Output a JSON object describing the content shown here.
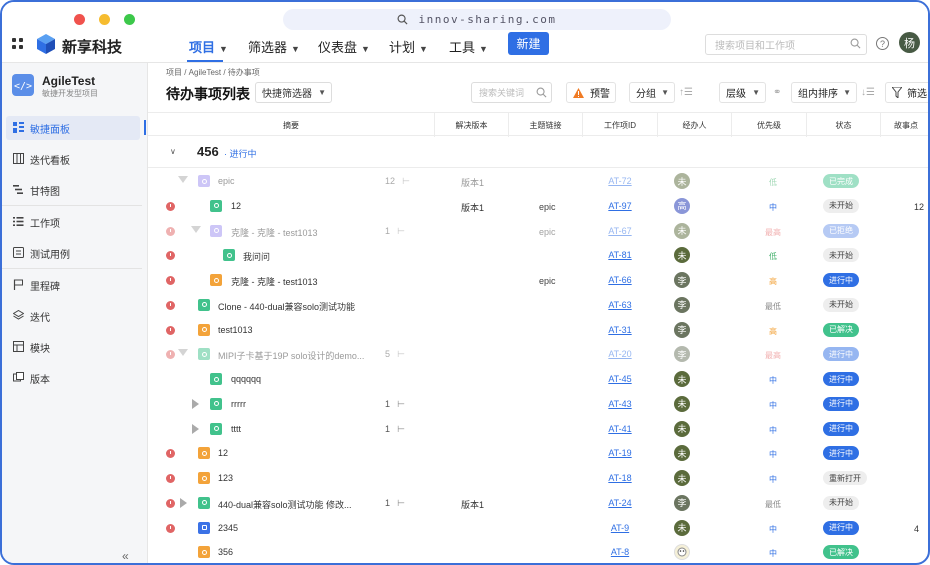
{
  "url": "innov-sharing.com",
  "brand": "新享科技",
  "nav": {
    "items": [
      {
        "label": "项目",
        "active": true
      },
      {
        "label": "筛选器"
      },
      {
        "label": "仪表盘"
      },
      {
        "label": "计划"
      },
      {
        "label": "工具"
      }
    ],
    "new_button": "新建",
    "search_placeholder": "搜索项目和工作项",
    "user_initial": "杨"
  },
  "sidebar": {
    "project_name": "AgileTest",
    "project_sub": "敏捷开发型项目",
    "items": [
      {
        "label": "敏捷面板",
        "icon": "board-icon",
        "active": true
      },
      {
        "label": "迭代看板",
        "icon": "kanban-icon"
      },
      {
        "label": "甘特图",
        "icon": "gantt-icon"
      },
      {
        "label": "工作项",
        "icon": "list-icon"
      },
      {
        "label": "测试用例",
        "icon": "testcase-icon"
      },
      {
        "label": "里程碑",
        "icon": "flag-icon"
      },
      {
        "label": "迭代",
        "icon": "layers-icon"
      },
      {
        "label": "模块",
        "icon": "module-icon"
      },
      {
        "label": "版本",
        "icon": "version-icon"
      }
    ],
    "collapse": "«"
  },
  "breadcrumb": "项目 / AgileTest / 待办事项",
  "page_title": "待办事项列表",
  "toolbar": {
    "quick_filter": "快捷筛选器",
    "keyword_placeholder": "搜索关键词",
    "warning": "预警",
    "group": "分组",
    "level": "层级",
    "inner_sort": "组内排序",
    "filter": "筛选"
  },
  "columns": [
    "摘要",
    "解决版本",
    "主题链接",
    "工作项ID",
    "经办人",
    "优先级",
    "状态",
    "故事点"
  ],
  "group": {
    "number": "456",
    "status": "· 进行中"
  },
  "colors": {
    "accent": "#2f6fe4",
    "overdue": "#e06565"
  },
  "rows": [
    {
      "title": "epic",
      "sub": "12",
      "version": "版本1",
      "topic": "",
      "id": "AT-72",
      "assignee": "未",
      "priority": "低",
      "status": "已完成",
      "points": "",
      "faded": true
    },
    {
      "title": "12",
      "sub": "",
      "version": "版本1",
      "topic": "epic",
      "id": "AT-97",
      "assignee": "高",
      "priority": "中",
      "status": "未开始",
      "points": "12",
      "faded": false
    },
    {
      "title": "克隆 - 克隆 - test1013",
      "sub": "1",
      "version": "",
      "topic": "epic",
      "id": "AT-67",
      "assignee": "未",
      "priority": "最高",
      "status": "已拒绝",
      "points": "",
      "faded": true
    },
    {
      "title": "我问问",
      "sub": "",
      "version": "",
      "topic": "",
      "id": "AT-81",
      "assignee": "未",
      "priority": "低",
      "status": "未开始",
      "points": "",
      "faded": false
    },
    {
      "title": "克隆 - 克隆 - test1013",
      "sub": "",
      "version": "",
      "topic": "epic",
      "id": "AT-66",
      "assignee": "李",
      "priority": "高",
      "status": "进行中",
      "points": "",
      "faded": false
    },
    {
      "title": "Clone - 440-dual兼容solo测试功能",
      "sub": "",
      "version": "",
      "topic": "",
      "id": "AT-63",
      "assignee": "李",
      "priority": "最低",
      "status": "未开始",
      "points": "",
      "faded": false
    },
    {
      "title": "test1013",
      "sub": "",
      "version": "",
      "topic": "",
      "id": "AT-31",
      "assignee": "李",
      "priority": "高",
      "status": "已解决",
      "points": "",
      "faded": false
    },
    {
      "title": "MIPI子卡基于19P solo设计的demo...",
      "sub": "5",
      "version": "",
      "topic": "",
      "id": "AT-20",
      "assignee": "李",
      "priority": "最高",
      "status": "进行中",
      "points": "",
      "faded": true
    },
    {
      "title": "qqqqqq",
      "sub": "",
      "version": "",
      "topic": "",
      "id": "AT-45",
      "assignee": "未",
      "priority": "中",
      "status": "进行中",
      "points": "",
      "faded": false
    },
    {
      "title": "rrrrr",
      "sub": "1",
      "version": "",
      "topic": "",
      "id": "AT-43",
      "assignee": "未",
      "priority": "中",
      "status": "进行中",
      "points": "",
      "faded": false
    },
    {
      "title": "tttt",
      "sub": "1",
      "version": "",
      "topic": "",
      "id": "AT-41",
      "assignee": "未",
      "priority": "中",
      "status": "进行中",
      "points": "",
      "faded": false
    },
    {
      "title": "12",
      "sub": "",
      "version": "",
      "topic": "",
      "id": "AT-19",
      "assignee": "未",
      "priority": "中",
      "status": "进行中",
      "points": "",
      "faded": false
    },
    {
      "title": "123",
      "sub": "",
      "version": "",
      "topic": "",
      "id": "AT-18",
      "assignee": "未",
      "priority": "中",
      "status": "重新打开",
      "points": "",
      "faded": false
    },
    {
      "title": "440-dual兼容solo测试功能 修改...",
      "sub": "1",
      "version": "版本1",
      "topic": "",
      "id": "AT-24",
      "assignee": "李",
      "priority": "最低",
      "status": "未开始",
      "points": "",
      "faded": false
    },
    {
      "title": "2345",
      "sub": "",
      "version": "",
      "topic": "",
      "id": "AT-9",
      "assignee": "未",
      "priority": "中",
      "status": "进行中",
      "points": "4",
      "faded": false
    },
    {
      "title": "356",
      "sub": "",
      "version": "",
      "topic": "",
      "id": "AT-8",
      "assignee": "",
      "priority": "中",
      "status": "已解决",
      "points": "",
      "faded": false
    }
  ]
}
